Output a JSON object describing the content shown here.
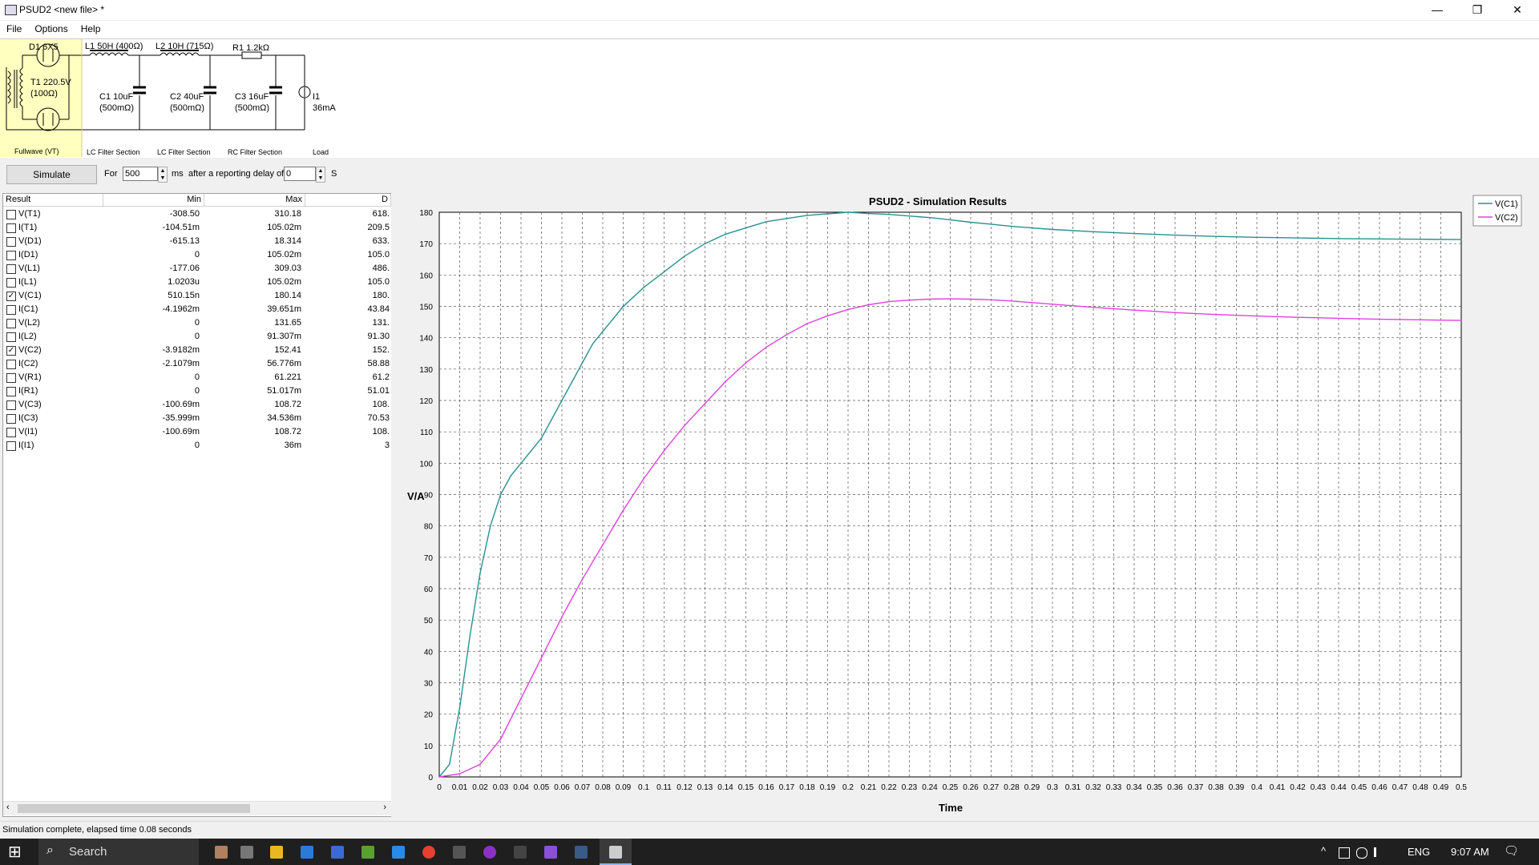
{
  "window": {
    "title": "PSUD2   <new file> *",
    "minimize": "—",
    "restore": "❐",
    "close": "✕"
  },
  "menu": [
    "File",
    "Options",
    "Help"
  ],
  "schematic": {
    "rectifier": {
      "top_label": "D1 6X5",
      "transformer_line1": "T1 220.5V",
      "transformer_line2": "(100Ω)",
      "section": "Fullwave (VT)"
    },
    "sections": [
      {
        "top_label": "L1 50H (400Ω)",
        "cap_line1": "C1 10uF",
        "cap_line2": "(500mΩ)",
        "section": "LC Filter Section"
      },
      {
        "top_label": "L2 10H (715Ω)",
        "cap_line1": "C2 40uF",
        "cap_line2": "(500mΩ)",
        "section": "LC Filter Section"
      },
      {
        "top_label": "R1 1.2kΩ",
        "cap_line1": "C3 16uF",
        "cap_line2": "(500mΩ)",
        "section": "RC Filter Section"
      }
    ],
    "load": {
      "line1": "I1",
      "line2": "36mA",
      "section": "Load"
    }
  },
  "controls": {
    "simulate_label": "Simulate",
    "for_label": "For",
    "duration_value": "500",
    "ms_label": "ms",
    "delay_label": "after a reporting delay of",
    "delay_value": "0",
    "s_label": "S"
  },
  "results": {
    "columns": [
      "Result",
      "Min",
      "Max",
      "D"
    ],
    "rows": [
      {
        "name": "V(T1)",
        "checked": false,
        "min": "-308.50",
        "max": "310.18",
        "d": "618."
      },
      {
        "name": "I(T1)",
        "checked": false,
        "min": "-104.51m",
        "max": "105.02m",
        "d": "209.5"
      },
      {
        "name": "V(D1)",
        "checked": false,
        "min": "-615.13",
        "max": "18.314",
        "d": "633."
      },
      {
        "name": "I(D1)",
        "checked": false,
        "min": "0",
        "max": "105.02m",
        "d": "105.0"
      },
      {
        "name": "V(L1)",
        "checked": false,
        "min": "-177.06",
        "max": "309.03",
        "d": "486."
      },
      {
        "name": "I(L1)",
        "checked": false,
        "min": "1.0203u",
        "max": "105.02m",
        "d": "105.0"
      },
      {
        "name": "V(C1)",
        "checked": true,
        "min": "510.15n",
        "max": "180.14",
        "d": "180."
      },
      {
        "name": "I(C1)",
        "checked": false,
        "min": "-4.1962m",
        "max": "39.651m",
        "d": "43.84"
      },
      {
        "name": "V(L2)",
        "checked": false,
        "min": "0",
        "max": "131.65",
        "d": "131."
      },
      {
        "name": "I(L2)",
        "checked": false,
        "min": "0",
        "max": "91.307m",
        "d": "91.30"
      },
      {
        "name": "V(C2)",
        "checked": true,
        "min": "-3.9182m",
        "max": "152.41",
        "d": "152."
      },
      {
        "name": "I(C2)",
        "checked": false,
        "min": "-2.1079m",
        "max": "56.776m",
        "d": "58.88"
      },
      {
        "name": "V(R1)",
        "checked": false,
        "min": "0",
        "max": "61.221",
        "d": "61.2"
      },
      {
        "name": "I(R1)",
        "checked": false,
        "min": "0",
        "max": "51.017m",
        "d": "51.01"
      },
      {
        "name": "V(C3)",
        "checked": false,
        "min": "-100.69m",
        "max": "108.72",
        "d": "108."
      },
      {
        "name": "I(C3)",
        "checked": false,
        "min": "-35.999m",
        "max": "34.536m",
        "d": "70.53"
      },
      {
        "name": "V(I1)",
        "checked": false,
        "min": "-100.69m",
        "max": "108.72",
        "d": "108."
      },
      {
        "name": "I(I1)",
        "checked": false,
        "min": "0",
        "max": "36m",
        "d": "3"
      }
    ]
  },
  "chart_data": {
    "type": "line",
    "title": "PSUD2 - Simulation Results",
    "xlabel": "Time",
    "ylabel": "V/A",
    "xlim": [
      0,
      0.5
    ],
    "ylim": [
      0,
      180
    ],
    "x_ticks": [
      "0",
      "0.01",
      "0.02",
      "0.03",
      "0.04",
      "0.05",
      "0.06",
      "0.07",
      "0.08",
      "0.09",
      "0.1",
      "0.11",
      "0.12",
      "0.13",
      "0.14",
      "0.15",
      "0.16",
      "0.17",
      "0.18",
      "0.19",
      "0.2",
      "0.21",
      "0.22",
      "0.23",
      "0.24",
      "0.25",
      "0.26",
      "0.27",
      "0.28",
      "0.29",
      "0.3",
      "0.31",
      "0.32",
      "0.33",
      "0.34",
      "0.35",
      "0.36",
      "0.37",
      "0.38",
      "0.39",
      "0.4",
      "0.41",
      "0.42",
      "0.43",
      "0.44",
      "0.45",
      "0.46",
      "0.47",
      "0.48",
      "0.49",
      "0.5"
    ],
    "y_ticks": [
      "0",
      "10",
      "20",
      "30",
      "40",
      "50",
      "60",
      "70",
      "80",
      "90",
      "100",
      "110",
      "120",
      "130",
      "140",
      "150",
      "160",
      "170",
      "180"
    ],
    "grid": true,
    "legend_position": "top-right, outside plot",
    "series": [
      {
        "name": "V(C1)",
        "color": "#2a9090",
        "x": [
          0,
          0.005,
          0.01,
          0.015,
          0.02,
          0.025,
          0.03,
          0.035,
          0.04,
          0.045,
          0.05,
          0.055,
          0.06,
          0.065,
          0.07,
          0.075,
          0.08,
          0.085,
          0.09,
          0.095,
          0.1,
          0.11,
          0.12,
          0.13,
          0.14,
          0.15,
          0.16,
          0.17,
          0.18,
          0.19,
          0.2,
          0.21,
          0.22,
          0.23,
          0.24,
          0.25,
          0.26,
          0.27,
          0.28,
          0.29,
          0.3,
          0.32,
          0.34,
          0.36,
          0.38,
          0.4,
          0.42,
          0.44,
          0.46,
          0.48,
          0.5
        ],
        "y": [
          0,
          4,
          22,
          45,
          65,
          80,
          90,
          96,
          100,
          104,
          108,
          114,
          120,
          126,
          132,
          138,
          142,
          146,
          150,
          153,
          156,
          161,
          166,
          170,
          173,
          175,
          177,
          178,
          179,
          179.5,
          180,
          179.6,
          179.3,
          178.8,
          178.3,
          177.6,
          176.8,
          176.2,
          175.5,
          175,
          174.5,
          173.8,
          173.2,
          172.7,
          172.3,
          172,
          171.8,
          171.6,
          171.5,
          171.4,
          171.3
        ]
      },
      {
        "name": "V(C2)",
        "color": "#e040e0",
        "x": [
          0,
          0.01,
          0.02,
          0.03,
          0.04,
          0.05,
          0.06,
          0.07,
          0.08,
          0.09,
          0.1,
          0.11,
          0.12,
          0.13,
          0.14,
          0.15,
          0.16,
          0.17,
          0.18,
          0.19,
          0.2,
          0.21,
          0.22,
          0.23,
          0.24,
          0.25,
          0.26,
          0.27,
          0.28,
          0.29,
          0.3,
          0.32,
          0.34,
          0.36,
          0.38,
          0.4,
          0.42,
          0.44,
          0.46,
          0.48,
          0.5
        ],
        "y": [
          0,
          1,
          4,
          12,
          25,
          38,
          51,
          63,
          74,
          85,
          95,
          104,
          112,
          119,
          126,
          132,
          137,
          141,
          144.5,
          147,
          149,
          150.5,
          151.5,
          152,
          152.3,
          152.4,
          152.3,
          152.1,
          151.7,
          151.2,
          150.7,
          149.7,
          148.8,
          148,
          147.4,
          146.9,
          146.5,
          146.2,
          145.9,
          145.7,
          145.5
        ]
      }
    ]
  },
  "status": {
    "text": "Simulation complete, elapsed time 0.08 seconds"
  },
  "taskbar": {
    "start_glyph": "⊞",
    "search_placeholder": "Search",
    "language": "ENG",
    "time": "9:07 AM",
    "tray_up_glyph": "^",
    "notify_glyph": "🗨"
  }
}
